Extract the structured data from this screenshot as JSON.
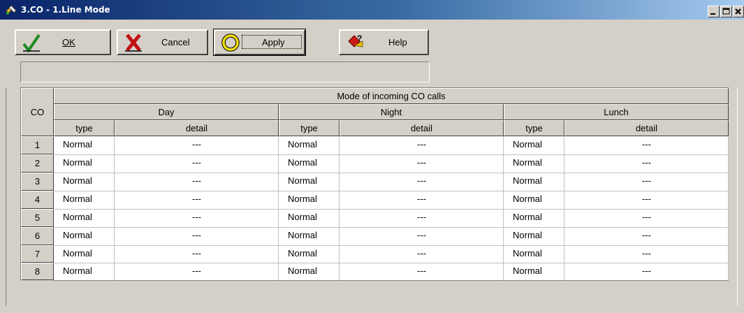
{
  "window": {
    "title": "3.CO - 1.Line Mode"
  },
  "toolbar": {
    "ok_label": "OK",
    "cancel_label": "Cancel",
    "apply_label": "Apply",
    "help_label": "Help"
  },
  "table": {
    "co_header": "CO",
    "group_header": "Mode of incoming CO calls",
    "periods": [
      "Day",
      "Night",
      "Lunch"
    ],
    "sub_headers": {
      "type": "type",
      "detail": "detail"
    },
    "rows": [
      {
        "co": "1",
        "day_type": "Normal",
        "day_detail": "---",
        "night_type": "Normal",
        "night_detail": "---",
        "lunch_type": "Normal",
        "lunch_detail": "---"
      },
      {
        "co": "2",
        "day_type": "Normal",
        "day_detail": "---",
        "night_type": "Normal",
        "night_detail": "---",
        "lunch_type": "Normal",
        "lunch_detail": "---"
      },
      {
        "co": "3",
        "day_type": "Normal",
        "day_detail": "---",
        "night_type": "Normal",
        "night_detail": "---",
        "lunch_type": "Normal",
        "lunch_detail": "---"
      },
      {
        "co": "4",
        "day_type": "Normal",
        "day_detail": "---",
        "night_type": "Normal",
        "night_detail": "---",
        "lunch_type": "Normal",
        "lunch_detail": "---"
      },
      {
        "co": "5",
        "day_type": "Normal",
        "day_detail": "---",
        "night_type": "Normal",
        "night_detail": "---",
        "lunch_type": "Normal",
        "lunch_detail": "---"
      },
      {
        "co": "6",
        "day_type": "Normal",
        "day_detail": "---",
        "night_type": "Normal",
        "night_detail": "---",
        "lunch_type": "Normal",
        "lunch_detail": "---"
      },
      {
        "co": "7",
        "day_type": "Normal",
        "day_detail": "---",
        "night_type": "Normal",
        "night_detail": "---",
        "lunch_type": "Normal",
        "lunch_detail": "---"
      },
      {
        "co": "8",
        "day_type": "Normal",
        "day_detail": "---",
        "night_type": "Normal",
        "night_detail": "---",
        "lunch_type": "Normal",
        "lunch_detail": "---"
      }
    ]
  },
  "icons": {
    "app": "phone-system-icon",
    "ok": "checkmark-icon",
    "cancel": "cross-icon",
    "apply": "ring-icon",
    "help": "help-icon"
  },
  "colors": {
    "face": "#d4d0c8",
    "title_start": "#0a246a",
    "title_end": "#a6caf0",
    "ok_green": "#1d8a1d",
    "cancel_red": "#c01010",
    "apply_yellow": "#f2e000",
    "help_red": "#d01818"
  }
}
